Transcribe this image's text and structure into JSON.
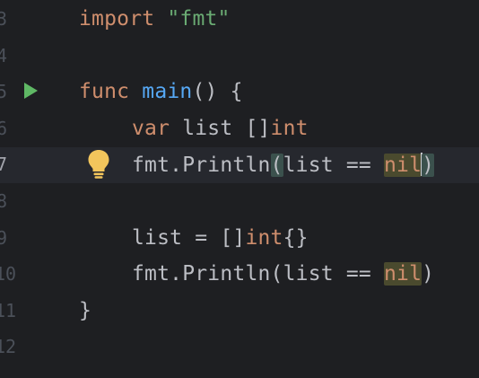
{
  "editor": {
    "lines": [
      {
        "number": "3",
        "code": {
          "kw1": "import",
          "space": " ",
          "str": "\"fmt\""
        }
      },
      {
        "number": "4"
      },
      {
        "number": "5",
        "code": {
          "kw": "func",
          "space": " ",
          "fn": "main",
          "rest": "() {"
        }
      },
      {
        "number": "6",
        "code": {
          "kw": "var",
          "mid": " list []",
          "kw2": "int"
        }
      },
      {
        "number": "7",
        "code": {
          "pkg": "fmt.",
          "fn": "Println",
          "open": "(",
          "mid": "list == ",
          "nil": "nil",
          "close": ")"
        }
      },
      {
        "number": "8"
      },
      {
        "number": "9",
        "code": {
          "pre": "list = []",
          "kw": "int",
          "post": "{}"
        }
      },
      {
        "number": "10",
        "code": {
          "pkg": "fmt.",
          "fn": "Println",
          "mid": "(list == ",
          "nil": "nil",
          "close": ")"
        }
      },
      {
        "number": "11",
        "code": {
          "text": "}"
        }
      },
      {
        "number": "12"
      }
    ],
    "run_icon": "run-triangle-icon",
    "intention_icon": "lightbulb-icon",
    "colors": {
      "background": "#1e1f22",
      "keyword": "#cf8e6d",
      "string": "#6aab73",
      "function": "#56a8f5",
      "text": "#bcbec4",
      "run": "#5fb865",
      "bulb": "#f2c55c"
    }
  }
}
